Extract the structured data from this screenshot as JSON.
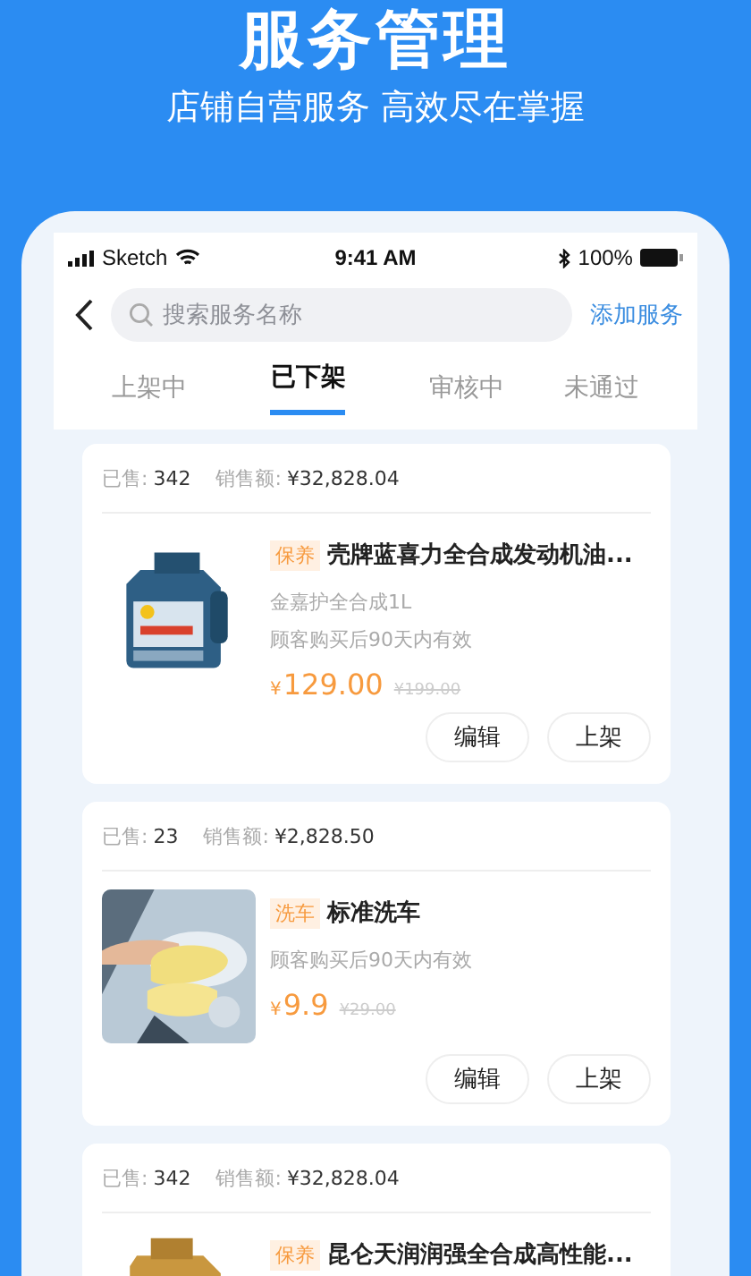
{
  "header": {
    "title": "服务管理",
    "subtitle": "店铺自营服务 高效尽在掌握"
  },
  "status_bar": {
    "carrier": "Sketch",
    "time": "9:41 AM",
    "battery": "100%"
  },
  "search": {
    "placeholder": "搜索服务名称"
  },
  "add_button": "添加服务",
  "tabs": [
    {
      "label": "上架中",
      "selected": false
    },
    {
      "label": "已下架",
      "selected": true
    },
    {
      "label": "审核中",
      "selected": false
    },
    {
      "label": "未通过",
      "selected": false
    }
  ],
  "services": [
    {
      "sold_label": "已售:",
      "sold": "342",
      "sales_label": "销售额:",
      "sales": "¥32,828.04",
      "image": {
        "kind": "picture"
      },
      "tag": "保养",
      "name": "壳牌蓝喜力全合成发动机油...",
      "spec": "金嘉护全合成1L",
      "validity": "顾客购买后90天内有效",
      "currency": "¥",
      "price": "129.00",
      "original_price": "¥199.00",
      "actions": [
        "编辑",
        "上架"
      ]
    },
    {
      "sold_label": "已售:",
      "sold": "23",
      "sales_label": "销售额:",
      "sales": "¥2,828.50",
      "image": {
        "kind": "picture"
      },
      "tag": "洗车",
      "name": "标准洗车",
      "validity": "顾客购买后90天内有效",
      "currency": "¥",
      "price": "9.9",
      "original_price": "¥29.00",
      "actions": [
        "编辑",
        "上架"
      ]
    },
    {
      "sold_label": "已售:",
      "sold": "342",
      "sales_label": "销售额:",
      "sales": "¥32,828.04",
      "image": {
        "kind": "picture"
      },
      "tag": "保养",
      "name": "昆仑天润润强全合成高性能..."
    }
  ]
}
